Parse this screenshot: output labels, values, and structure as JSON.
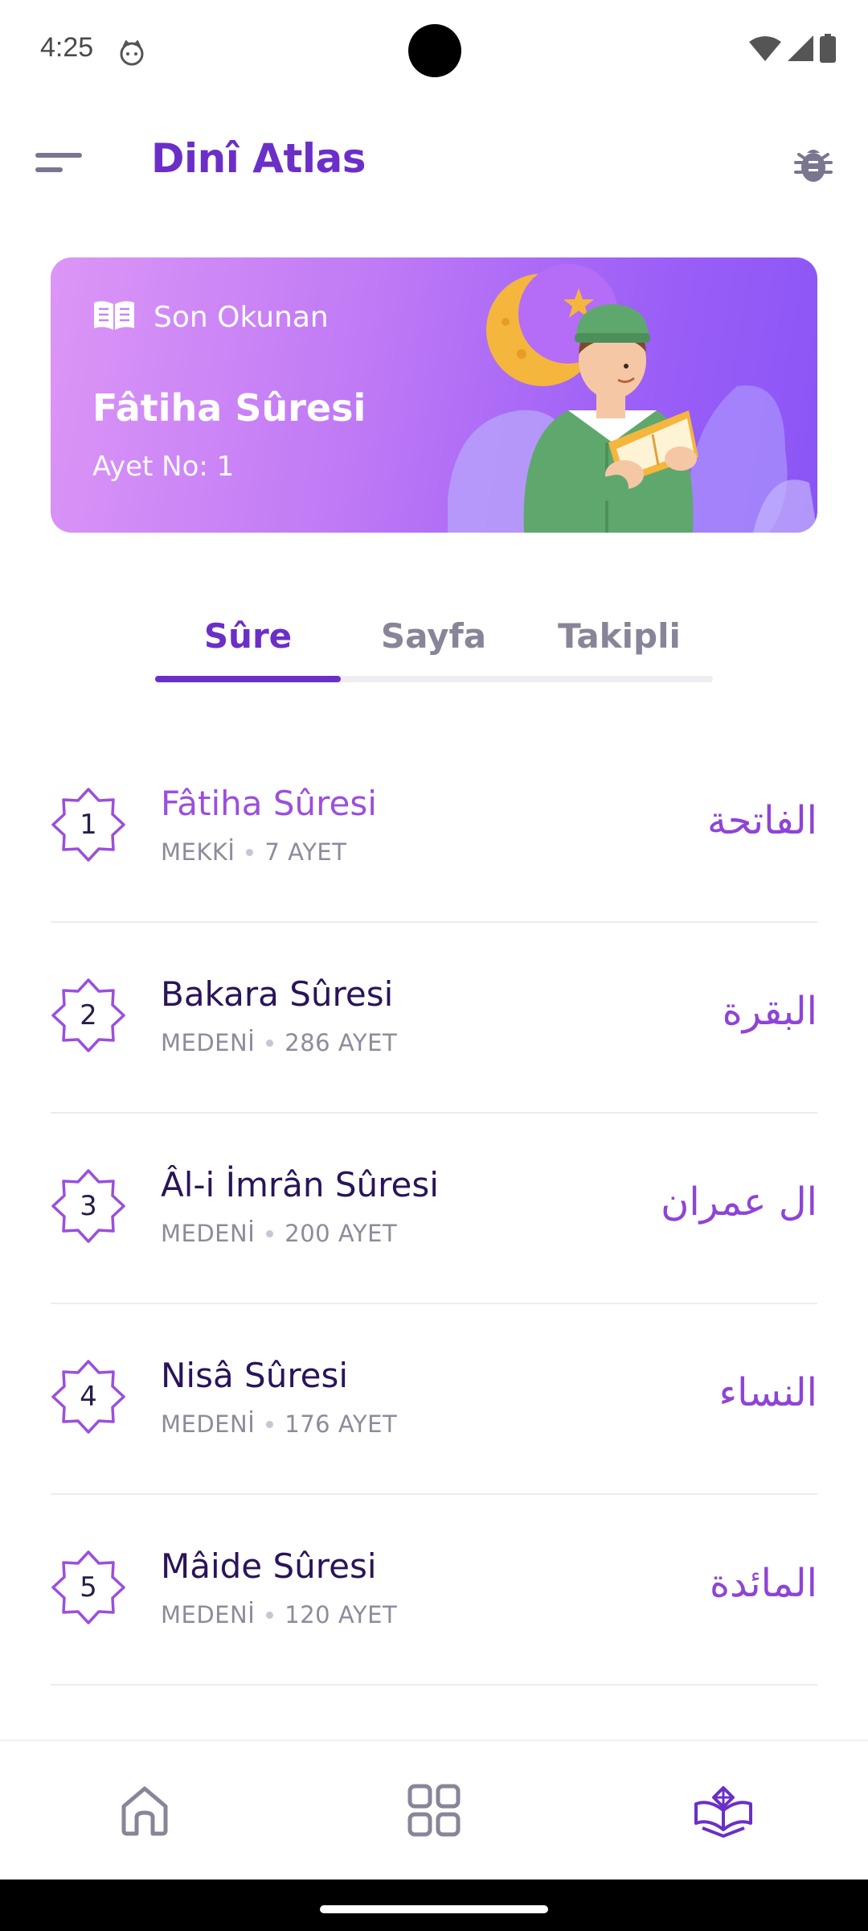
{
  "status_bar": {
    "time": "4:25",
    "icons": [
      "notification-cat-icon",
      "wifi-icon",
      "signal-icon",
      "battery-icon"
    ]
  },
  "app_bar": {
    "title": "Dinî Atlas",
    "menu_icon": "menu-icon",
    "debug_icon": "bug-icon"
  },
  "last_read": {
    "header_label": "Son Okunan",
    "header_icon": "book-open-icon",
    "surah_title": "Fâtiha Sûresi",
    "ayah_label": "Ayet No: 1"
  },
  "tabs": [
    {
      "label": "Sûre",
      "active": true
    },
    {
      "label": "Sayfa",
      "active": false
    },
    {
      "label": "Takipli",
      "active": false
    }
  ],
  "surahs": [
    {
      "number": "1",
      "name": "Fâtiha Sûresi",
      "revelation": "MEKKİ",
      "ayah_count": "7 AYET",
      "arabic": "الفاتحة",
      "current": true
    },
    {
      "number": "2",
      "name": "Bakara Sûresi",
      "revelation": "MEDENİ",
      "ayah_count": "286 AYET",
      "arabic": "البقرة",
      "current": false
    },
    {
      "number": "3",
      "name": "Âl-i İmrân Sûresi",
      "revelation": "MEDENİ",
      "ayah_count": "200 AYET",
      "arabic": "ال عمران",
      "current": false
    },
    {
      "number": "4",
      "name": "Nisâ Sûresi",
      "revelation": "MEDENİ",
      "ayah_count": "176 AYET",
      "arabic": "النساء",
      "current": false
    },
    {
      "number": "5",
      "name": "Mâide Sûresi",
      "revelation": "MEDENİ",
      "ayah_count": "120 AYET",
      "arabic": "المائدة",
      "current": false
    }
  ],
  "bottom_nav": [
    {
      "icon": "home-icon",
      "active": false
    },
    {
      "icon": "grid-icon",
      "active": false
    },
    {
      "icon": "quran-book-icon",
      "active": true
    }
  ],
  "colors": {
    "primary": "#6b2fc8",
    "accent_text": "#9b4fdc",
    "arabic_text": "#8e44d6",
    "inactive_icon": "#8a8499",
    "card_gradient_start": "#dc96f6",
    "card_gradient_end": "#8a55f6"
  }
}
